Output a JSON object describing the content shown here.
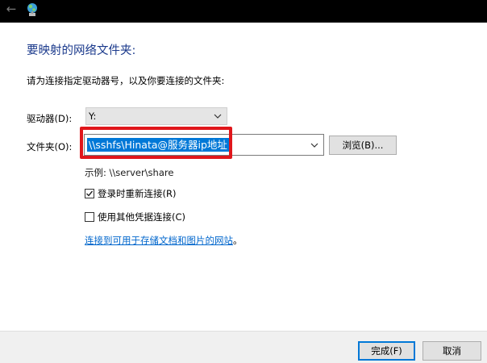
{
  "titlebar": {
    "back_icon": "back-arrow-icon",
    "app_icon": "network-drive-icon"
  },
  "heading": "要映射的网络文件夹:",
  "instruction": "请为连接指定驱动器号，以及你要连接的文件夹:",
  "drive": {
    "label": "驱动器(D):",
    "value": "Y:"
  },
  "folder": {
    "label": "文件夹(O):",
    "value": "\\\\sshfs\\Hinata@服务器ip地址"
  },
  "browse_button": "浏览(B)...",
  "example": "示例: \\\\server\\share",
  "options": {
    "reconnect_label": "登录时重新连接(R)",
    "reconnect_checked": true,
    "other_credentials_label": "使用其他凭据连接(C)",
    "other_credentials_checked": false
  },
  "link_text": "连接到可用于存储文档和图片的网站",
  "link_suffix": "。",
  "footer": {
    "finish_button": "完成(F)",
    "cancel_button": "取消"
  },
  "colors": {
    "heading": "#1b3a8c",
    "selection": "#0078d7",
    "annotation_box": "#e0161b",
    "link": "#0066cc"
  }
}
